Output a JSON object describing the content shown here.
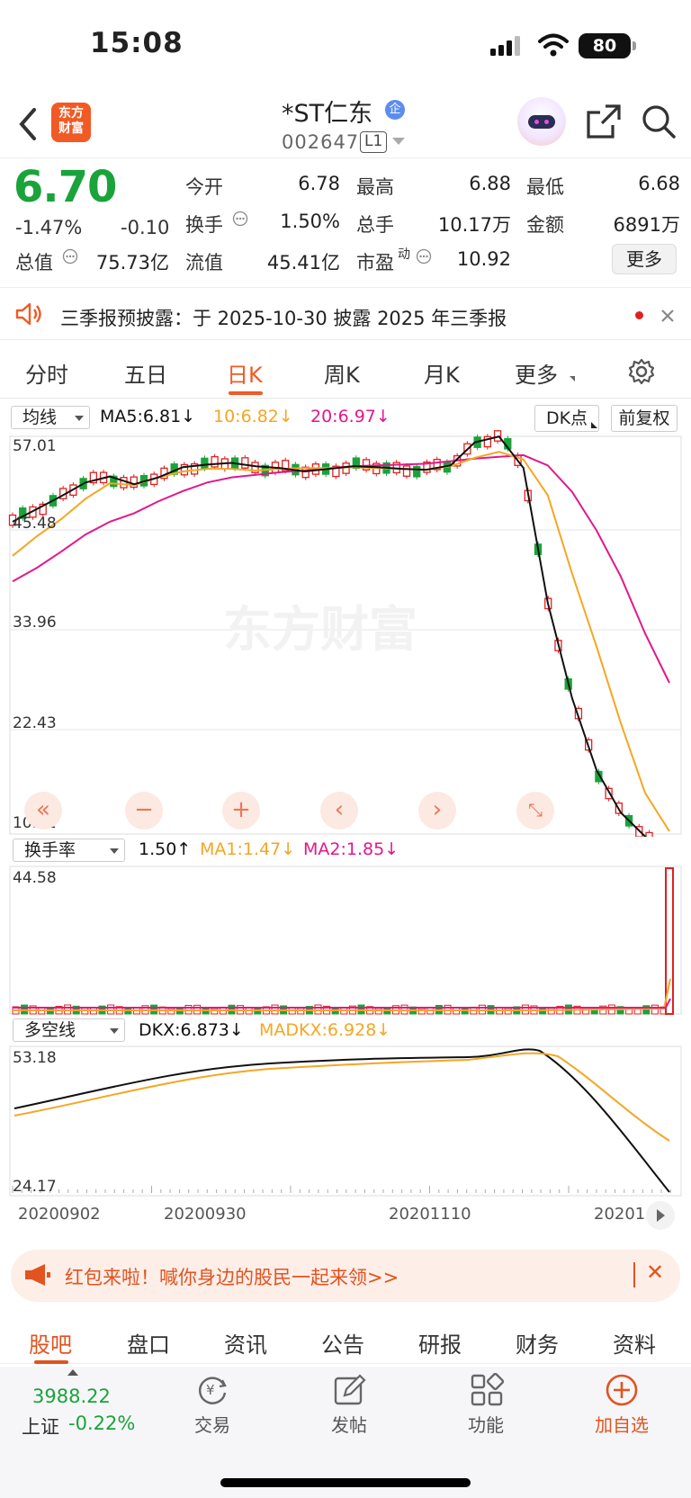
{
  "status_bar": {
    "time": "15:08",
    "battery": "80"
  },
  "header": {
    "logo": "东方\n财富",
    "title": "*ST仁东",
    "badge": "企",
    "code": "002647",
    "level": "L1"
  },
  "quote": {
    "price": "6.70",
    "change_pct": "-1.47%",
    "change": "-0.10",
    "open_label": "今开",
    "open": "6.78",
    "high_label": "最高",
    "high": "6.88",
    "low_label": "最低",
    "low": "6.68",
    "turnover_label": "换手",
    "turnover": "1.50%",
    "volume_label": "总手",
    "volume": "10.17万",
    "amount_label": "金额",
    "amount": "6891万",
    "mktcap_label": "总值",
    "mktcap": "75.73亿",
    "float_label": "流值",
    "float_cap": "45.41亿",
    "pe_label": "市盈",
    "pe_sup": "动",
    "pe": "10.92",
    "more": "更多"
  },
  "notice": {
    "text": "三季报预披露：于 2025-10-30 披露 2025 年三季报"
  },
  "period_tabs": [
    "分时",
    "五日",
    "日K",
    "周K",
    "月K",
    "更多"
  ],
  "active_period": "日K",
  "main_chart": {
    "selector": "均线",
    "ma5": "MA5:6.81",
    "ma10": "10:6.82",
    "ma20": "20:6.97",
    "dk": "DK点",
    "adjust": "前复权",
    "y_labels": [
      "57.01",
      "45.48",
      "33.96",
      "22.43",
      "10.91"
    ],
    "watermark": "东方财富"
  },
  "turnover_chart": {
    "selector": "换手率",
    "value": "1.50",
    "ma1": "MA1:1.47",
    "ma2": "MA2:1.85",
    "y_labels": [
      "44.58"
    ]
  },
  "dkx_chart": {
    "selector": "多空线",
    "dkx": "DKX:6.873",
    "madkx": "MADKX:6.928",
    "y_labels": [
      "53.18",
      "24.17"
    ]
  },
  "x_dates": [
    "20200902",
    "20200930",
    "20201110",
    "20201"
  ],
  "colors": {
    "up": "#e02020",
    "down": "#1aa33a",
    "accent": "#f15a24",
    "ma10": "#f5a623",
    "ma20": "#e0198c"
  },
  "chart_data": [
    {
      "type": "line",
      "title": "",
      "series": [
        {
          "name": "MA5",
          "values": [
            47,
            48.5,
            50,
            51.6,
            52.3,
            51.4,
            52.2,
            53.4,
            53.7,
            53.9,
            53.5,
            53.3,
            52.9,
            53.2,
            53.5,
            53.4,
            53.2,
            53.1,
            53.6,
            56.3,
            57.0,
            53.3,
            37.5,
            26.3,
            17.9,
            12.9,
            10.1,
            7.7
          ]
        },
        {
          "name": "10",
          "values": [
            43,
            45.3,
            47.3,
            49.7,
            51.5,
            51.3,
            52.2,
            52.9,
            53.2,
            53.2,
            53.0,
            53.2,
            53.3,
            53.3,
            53.4,
            53.3,
            53.2,
            53.1,
            53.5,
            54.5,
            55.2,
            54.3,
            50.1,
            40.9,
            32.4,
            23.4,
            15.2,
            10.7
          ]
        },
        {
          "name": "20",
          "values": [
            40,
            41.6,
            43.5,
            45.5,
            47.0,
            48.0,
            49.4,
            50.6,
            51.6,
            52.2,
            52.5,
            52.8,
            53.0,
            53.3,
            53.5,
            53.6,
            53.7,
            53.8,
            54.1,
            54.4,
            54.6,
            54.8,
            53.6,
            50.5,
            46.0,
            40.6,
            33.9,
            28.1
          ]
        }
      ],
      "ylim": [
        10.91,
        57.01
      ]
    }
  ],
  "promo": {
    "text": "红包来啦！喊你身边的股民一起来领>>"
  },
  "bottom_tabs": [
    "股吧",
    "盘口",
    "资讯",
    "公告",
    "研报",
    "财务",
    "资料"
  ],
  "bottom_nav": {
    "index_value": "3988.22",
    "index_name": "上证",
    "index_change": "-0.22%",
    "trade": "交易",
    "post": "发帖",
    "func": "功能",
    "add": "加自选"
  }
}
